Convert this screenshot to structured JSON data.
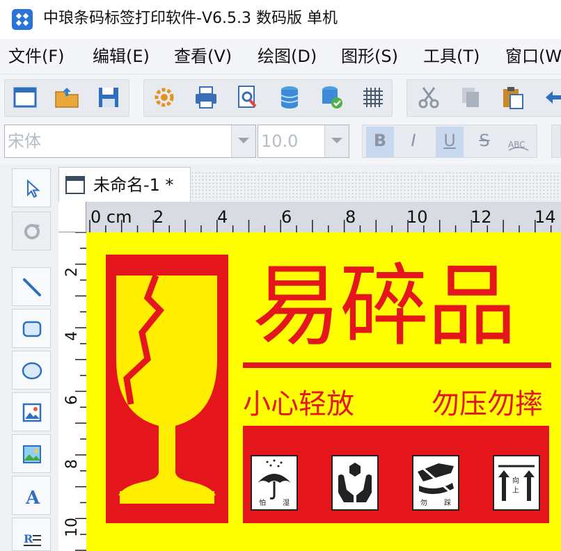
{
  "app": {
    "title": "中琅条码标签打印软件-V6.5.3 数码版 单机"
  },
  "menu": {
    "items": [
      {
        "label": "文件(F)"
      },
      {
        "label": "编辑(E)"
      },
      {
        "label": "查看(V)"
      },
      {
        "label": "绘图(D)"
      },
      {
        "label": "图形(S)"
      },
      {
        "label": "工具(T)"
      },
      {
        "label": "窗口(W"
      }
    ]
  },
  "format": {
    "font_name_value": "宋体",
    "font_size_value": "10.0",
    "bold_label": "B",
    "italic_label": "I",
    "underline_label": "U",
    "strike_label": "S"
  },
  "document": {
    "tab_label": "未命名-1 *"
  },
  "ruler": {
    "top_labels": [
      "0 cm",
      "2",
      "4",
      "6",
      "8",
      "10",
      "12",
      "14"
    ],
    "left_labels": [
      "2",
      "4",
      "6",
      "8",
      "10"
    ]
  },
  "label": {
    "title": "易碎品",
    "subtitle_left": "小心轻放",
    "subtitle_right": "勿压勿摔",
    "pictograms": [
      {
        "caption": "怕 湿",
        "icon": "umbrella-icon"
      },
      {
        "caption": "",
        "icon": "hands-box-icon"
      },
      {
        "caption": "勿 踩",
        "icon": "no-step-icon"
      },
      {
        "caption": "向上",
        "icon": "this-way-up-icon"
      }
    ]
  },
  "colors": {
    "label_background": "#ffff00",
    "label_red": "#e4161c",
    "toolbar_background": "#f3f5f8"
  }
}
